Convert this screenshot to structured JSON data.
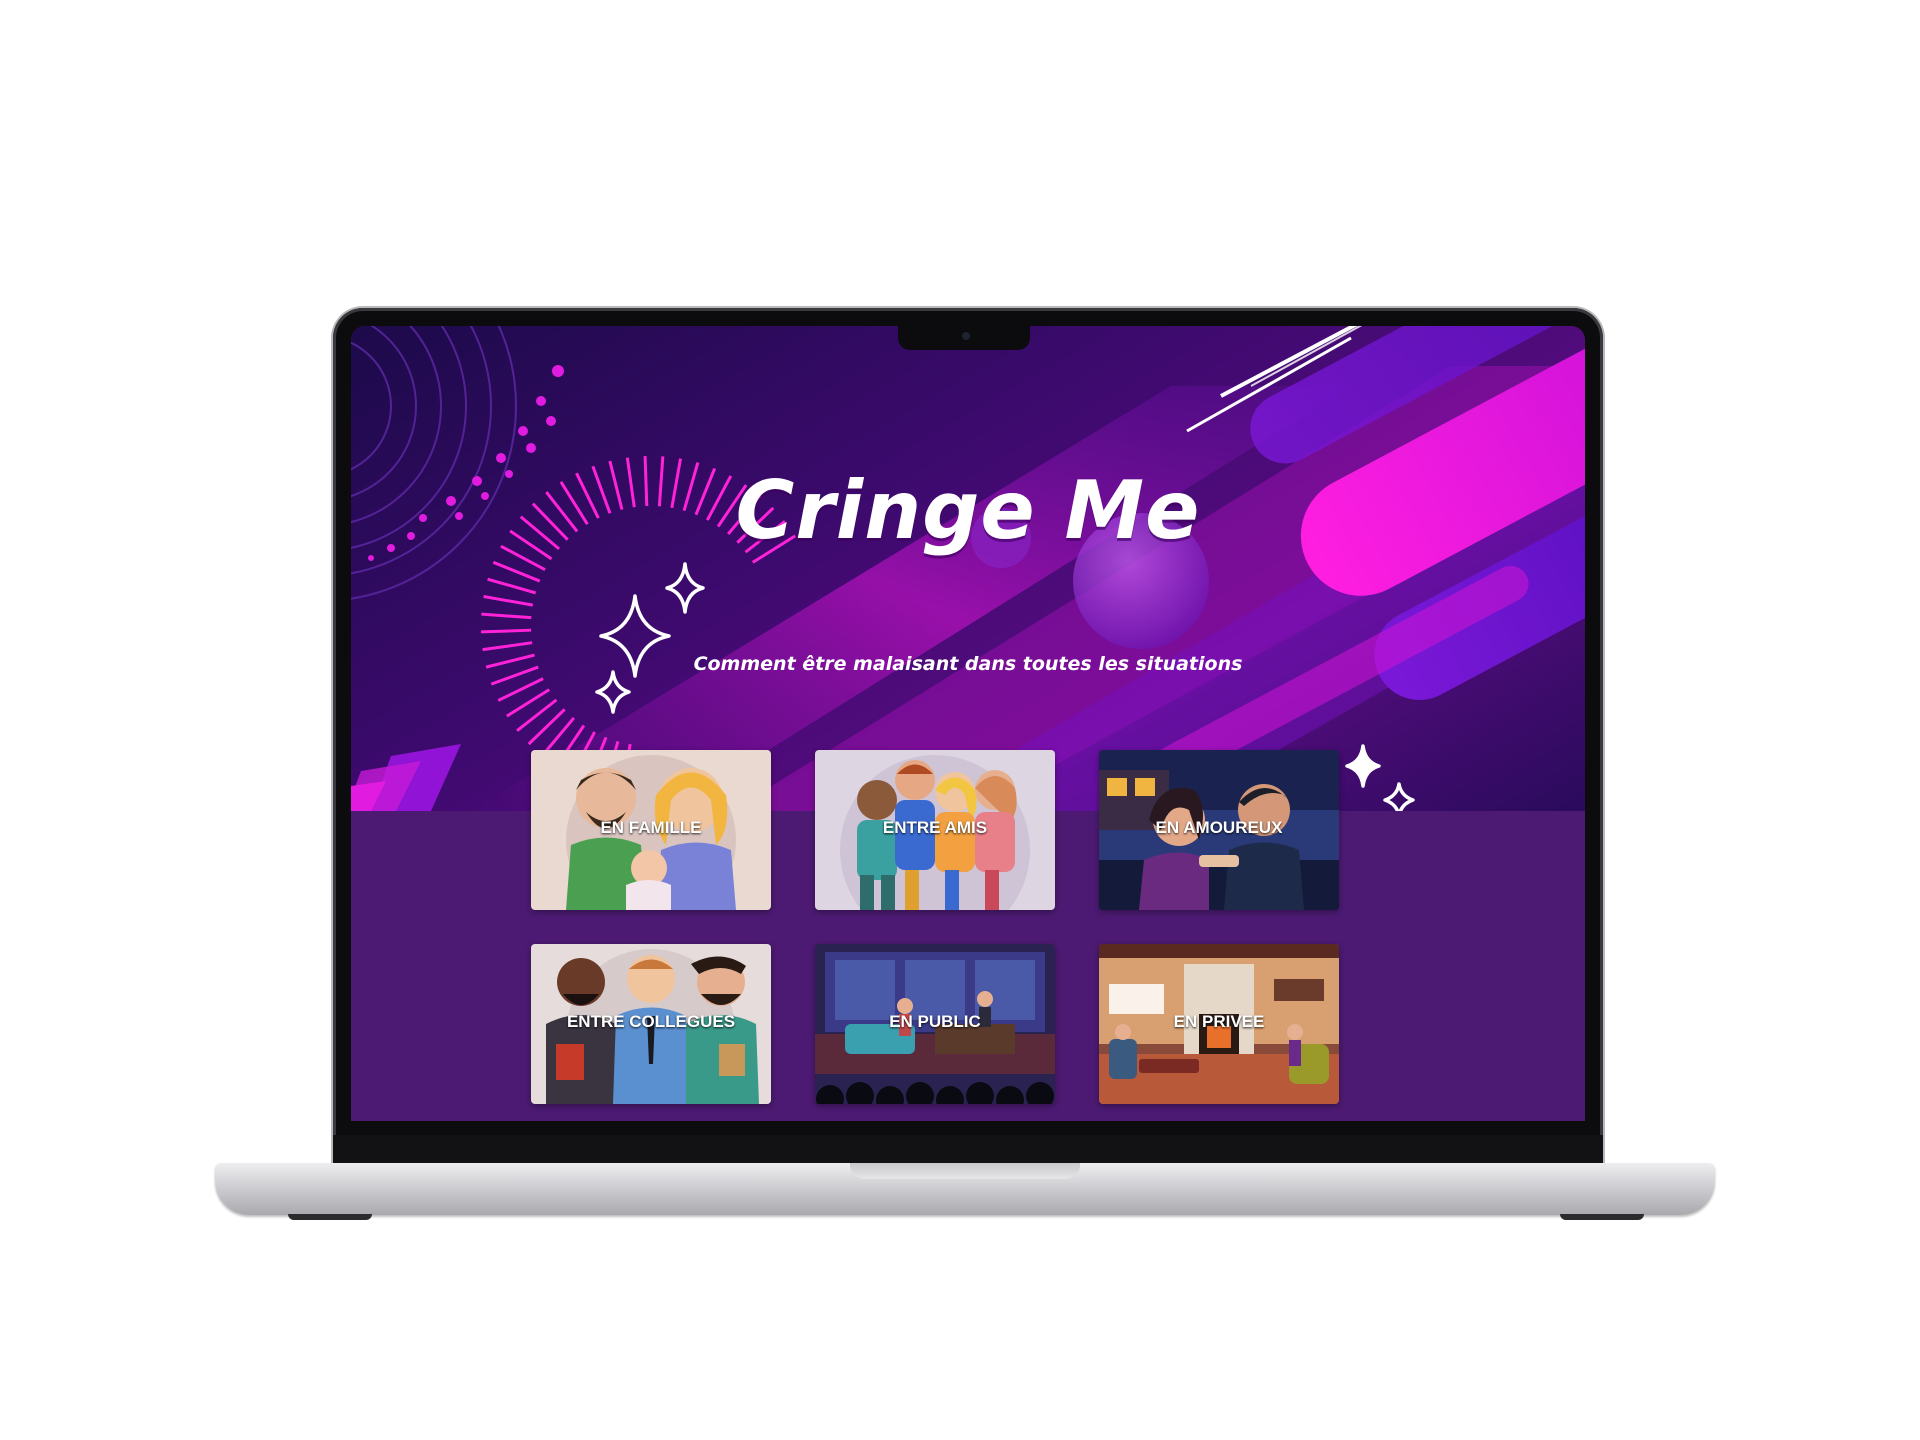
{
  "site": {
    "title": "Cringe Me",
    "subtitle": "Comment être malaisant dans toutes les situations"
  },
  "categories": [
    {
      "label": "EN FAMILLE",
      "icon": "family-illustration"
    },
    {
      "label": "ENTRE AMIS",
      "icon": "friends-illustration"
    },
    {
      "label": "EN AMOUREUX",
      "icon": "couple-illustration"
    },
    {
      "label": "ENTRE COLLEGUES",
      "icon": "coworkers-illustration"
    },
    {
      "label": "EN PUBLIC",
      "icon": "stage-illustration"
    },
    {
      "label": "EN PRIVEE",
      "icon": "living-room-illustration"
    }
  ],
  "colors": {
    "accent": "#ff1ee0",
    "hero_dark": "#1c0a4a",
    "hero_mid": "#5a0c82",
    "lower_bg": "#4c1a72"
  }
}
